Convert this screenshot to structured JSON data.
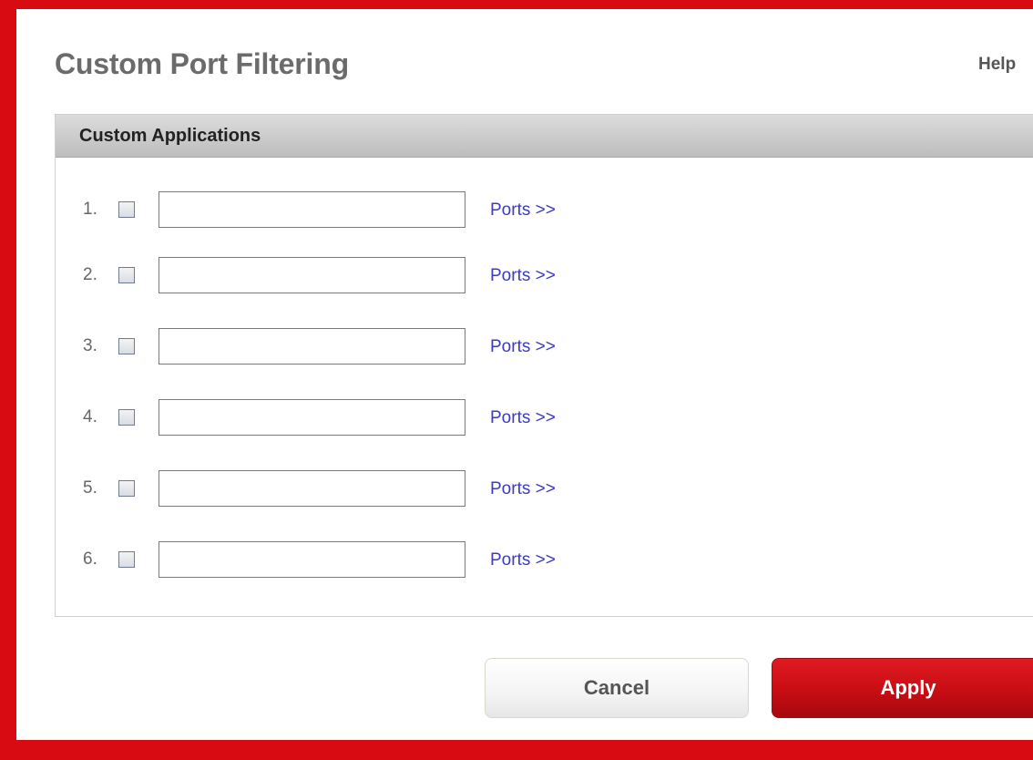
{
  "page": {
    "title": "Custom Port Filtering",
    "help_label": "Help"
  },
  "panel": {
    "title": "Custom Applications"
  },
  "rows": [
    {
      "number": "1.",
      "checked": false,
      "value": "",
      "ports_label": "Ports >>"
    },
    {
      "number": "2.",
      "checked": false,
      "value": "",
      "ports_label": "Ports >>"
    },
    {
      "number": "3.",
      "checked": false,
      "value": "",
      "ports_label": "Ports >>"
    },
    {
      "number": "4.",
      "checked": false,
      "value": "",
      "ports_label": "Ports >>"
    },
    {
      "number": "5.",
      "checked": false,
      "value": "",
      "ports_label": "Ports >>"
    },
    {
      "number": "6.",
      "checked": false,
      "value": "",
      "ports_label": "Ports >>"
    }
  ],
  "buttons": {
    "cancel_label": "Cancel",
    "apply_label": "Apply"
  },
  "colors": {
    "brand_red": "#d90b12",
    "link_blue": "#3b3bbf",
    "title_gray": "#6b6b6b"
  }
}
